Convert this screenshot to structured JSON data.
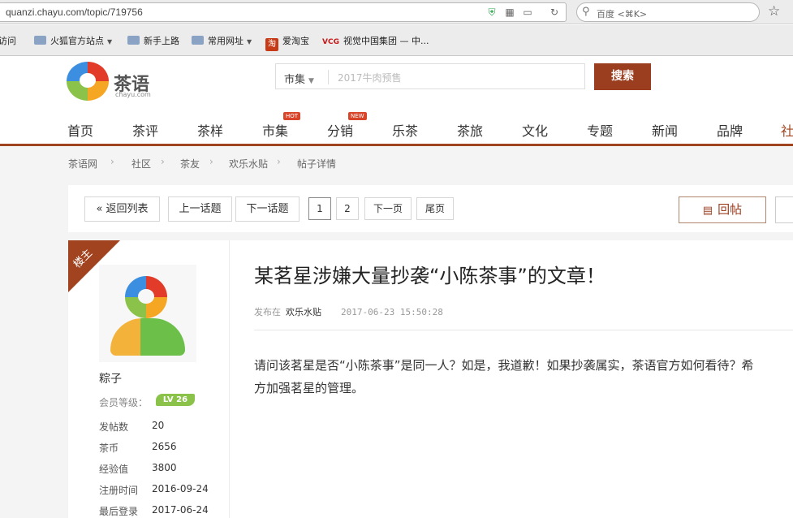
{
  "browser": {
    "url": "quanzi.chayu.com/topic/719756",
    "search_placeholder": "百度 <⌘K>",
    "bookmarks": [
      {
        "label": "访问",
        "icon": "folder-icon"
      },
      {
        "label": "火狐官方站点",
        "icon": "folder-icon",
        "dropdown": true
      },
      {
        "label": "新手上路",
        "icon": "folder-icon"
      },
      {
        "label": "常用网址",
        "icon": "folder-icon",
        "dropdown": true
      },
      {
        "label": "爱淘宝",
        "icon": "taobao-icon",
        "icon_text": "淘"
      },
      {
        "label": "视觉中国集团 — 中...",
        "icon": "vcg-icon",
        "icon_text": "VCG"
      }
    ]
  },
  "site": {
    "logo_cn": "茶语",
    "logo_en": "chayu.com",
    "search_category": "市集",
    "search_placeholder": "2017牛肉预售",
    "search_button": "搜索",
    "nav": [
      {
        "label": "首页"
      },
      {
        "label": "茶评"
      },
      {
        "label": "茶样"
      },
      {
        "label": "市集",
        "badge": "HOT"
      },
      {
        "label": "分销",
        "badge": "NEW"
      },
      {
        "label": "乐茶"
      },
      {
        "label": "茶旅"
      },
      {
        "label": "文化"
      },
      {
        "label": "专题"
      },
      {
        "label": "新闻"
      },
      {
        "label": "品牌"
      },
      {
        "label": "社"
      }
    ],
    "accent": "#9b3d1f"
  },
  "breadcrumb": [
    "茶语网",
    "社区",
    "茶友",
    "欢乐水贴",
    "帖子详情"
  ],
  "toolbar": {
    "back": "返回列表",
    "prev": "上一话题",
    "next": "下一话题",
    "pages": [
      "1",
      "2"
    ],
    "next_page": "下一页",
    "last_page": "尾页",
    "reply": "回帖"
  },
  "author": {
    "ribbon": "楼主",
    "name": "粽子",
    "level_label": "会员等级：",
    "level": "LV 26",
    "stats": [
      {
        "key": "发帖数",
        "value": "20"
      },
      {
        "key": "茶币",
        "value": "2656"
      },
      {
        "key": "经验值",
        "value": "3800"
      },
      {
        "key": "注册时间",
        "value": "2016-09-24"
      },
      {
        "key": "最后登录",
        "value": "2017-06-24"
      }
    ]
  },
  "post": {
    "title": "某茗星涉嫌大量抄袭“小陈茶事”的文章！",
    "posted_in": "发布在",
    "board": "欢乐水贴",
    "time": "2017-06-23 15:50:28",
    "body_line1": "请问该茗星是否“小陈茶事”是同一人？如是，我道歉！如果抄袭属实，茶语官方如何看待？希",
    "body_line2": "方加强茗星的管理。"
  }
}
